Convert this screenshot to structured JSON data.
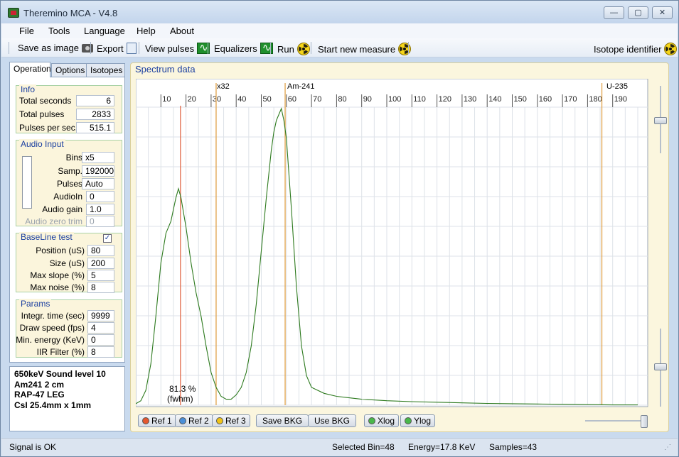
{
  "window": {
    "title": "Theremino MCA - V4.8"
  },
  "menu": [
    "File",
    "Tools",
    "Language",
    "Help",
    "About"
  ],
  "toolbar": {
    "save_image": "Save as image",
    "export": "Export",
    "view_pulses": "View pulses",
    "equalizers": "Equalizers",
    "run": "Run",
    "start_new": "Start new measure",
    "isotope_identifier": "Isotope identifier"
  },
  "tabs": [
    "Operation",
    "Options",
    "Isotopes"
  ],
  "info": {
    "title": "Info",
    "total_seconds_label": "Total seconds",
    "total_seconds": "6",
    "total_pulses_label": "Total pulses",
    "total_pulses": "2833",
    "pps_label": "Pulses per sec.",
    "pps": "515.1"
  },
  "audio": {
    "title": "Audio Input",
    "bins_label": "Bins",
    "bins": "x5",
    "samp_label": "Samp.",
    "samp": "192000",
    "pulses_label": "Pulses",
    "pulses": "Auto",
    "audioin_label": "AudioIn",
    "audioin": "0",
    "gain_label": "Audio gain",
    "gain": "1.0",
    "zero_trim_label": "Audio zero trim",
    "zero_trim": "0"
  },
  "baseline": {
    "title": "BaseLine test",
    "checked": "✓",
    "position_label": "Position (uS)",
    "position": "80",
    "size_label": "Size (uS)",
    "size": "200",
    "max_slope_label": "Max slope (%)",
    "max_slope": "5",
    "max_noise_label": "Max noise (%)",
    "max_noise": "8"
  },
  "params": {
    "title": "Params",
    "integr_label": "Integr. time (sec)",
    "integr": "9999",
    "draw_label": "Draw speed (fps)",
    "draw": "4",
    "min_energy_label": "Min. energy (KeV)",
    "min_energy": "0",
    "iir_label": "IIR Filter (%)",
    "iir": "8"
  },
  "notes": [
    "650keV Sound level 10",
    "Am241 2 cm",
    "RAP-47 LEG",
    "CsI 25.4mm x 1mm"
  ],
  "spectrum": {
    "title": "Spectrum data",
    "marker_x32": "x32",
    "marker_am": "Am-241",
    "marker_u": "U-235",
    "fwhm_pct": "81.3 %",
    "fwhm_label": "(fwhm)"
  },
  "chart_data": {
    "type": "line",
    "x_ticks": [
      10,
      20,
      30,
      40,
      50,
      60,
      70,
      80,
      90,
      100,
      110,
      120,
      130,
      140,
      150,
      160,
      170,
      180,
      190
    ],
    "xlim": [
      0,
      200
    ],
    "ylim": [
      0,
      100
    ],
    "grid": true,
    "markers": [
      {
        "name": "x32",
        "x": 32
      },
      {
        "name": "Am-241",
        "x": 59.5
      },
      {
        "name": "U-235",
        "x": 185.7
      },
      {
        "name": "",
        "x": 17.8
      }
    ],
    "series": [
      {
        "x": [
          0,
          2,
          4,
          6,
          8,
          10,
          12,
          14,
          15,
          16,
          17,
          18,
          20,
          22,
          24,
          26,
          28,
          30,
          32,
          34,
          36,
          38,
          40,
          42,
          44,
          46,
          48,
          50,
          52,
          54,
          55,
          56,
          57,
          58,
          59,
          60,
          62,
          64,
          66,
          68,
          70,
          75,
          80,
          85,
          90,
          100,
          110,
          120,
          130,
          140,
          150,
          160,
          170,
          180,
          190,
          200
        ],
        "y": [
          0.5,
          1.5,
          5,
          14,
          30,
          48,
          58,
          62,
          66,
          70,
          73,
          70,
          60,
          48,
          38,
          30,
          20,
          11,
          6,
          3,
          2,
          2,
          3.5,
          6,
          11,
          20,
          34,
          52,
          70,
          86,
          92,
          96,
          98,
          100,
          96,
          90,
          66,
          40,
          20,
          10,
          6,
          4,
          3,
          2.5,
          2,
          1.5,
          1.2,
          1,
          0.8,
          0.6,
          0.5,
          0.4,
          0.3,
          0.2,
          0.1,
          0.1
        ]
      }
    ]
  },
  "buttons": {
    "ref1": "Ref 1",
    "ref2": "Ref 2",
    "ref3": "Ref 3",
    "save_bkg": "Save BKG",
    "use_bkg": "Use BKG",
    "xlog": "Xlog",
    "ylog": "Ylog"
  },
  "status": {
    "signal": "Signal is OK",
    "selected_bin": "Selected Bin=48",
    "energy": "Energy=17.8 KeV",
    "samples": "Samples=43"
  }
}
